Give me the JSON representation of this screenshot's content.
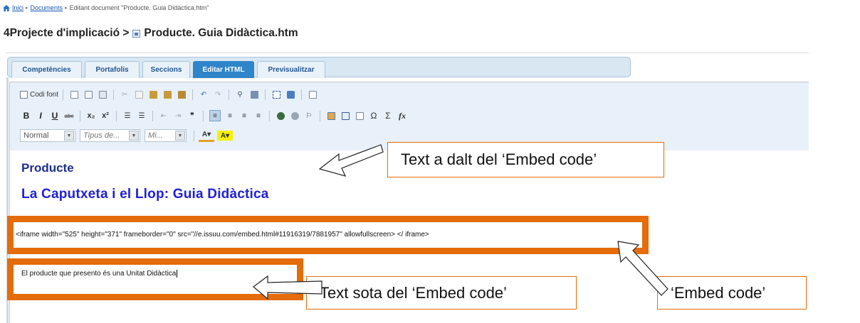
{
  "breadcrumb": {
    "home": "Inici",
    "documents": "Documents",
    "current": "Editant document \"Producte. Guia Didàctica.htm\""
  },
  "page_title": {
    "prefix": "4Projecte d'implicació >",
    "file": "Producte. Guia Didàctica.htm"
  },
  "tabs": [
    {
      "label": "Competències",
      "active": false
    },
    {
      "label": "Portafolis",
      "active": false
    },
    {
      "label": "Seccions",
      "active": false
    },
    {
      "label": "Editar HTML",
      "active": true
    },
    {
      "label": "Previsualitzar",
      "active": false
    }
  ],
  "toolbar": {
    "source_label": "Codi font",
    "bold": "B",
    "italic": "I",
    "underline": "U",
    "format_value": "Normal",
    "font_placeholder": "Tipus de...",
    "size_placeholder": "Mi..."
  },
  "content": {
    "heading1": "Producte",
    "heading2": "La Caputxeta i el Llop: Guia Didàctica",
    "embed_code": "<iframe width=\"525\" height=\"371\" frameborder=\"0\" src=\"//e.issuu.com/embed.html#11916319/7881957\" allowfullscreen> </ iframe>",
    "paragraph": "El producte que presento és una Unitat Didàctica"
  },
  "annotations": {
    "above": "Text a dalt del ‘Embed code’",
    "below": "Text sota del ‘Embed code’",
    "embed": "‘Embed code’"
  },
  "colors": {
    "annotation": "#e46c0a",
    "active_tab": "#2f85c9",
    "heading1": "#1b2f8c",
    "heading2": "#2020d6"
  }
}
